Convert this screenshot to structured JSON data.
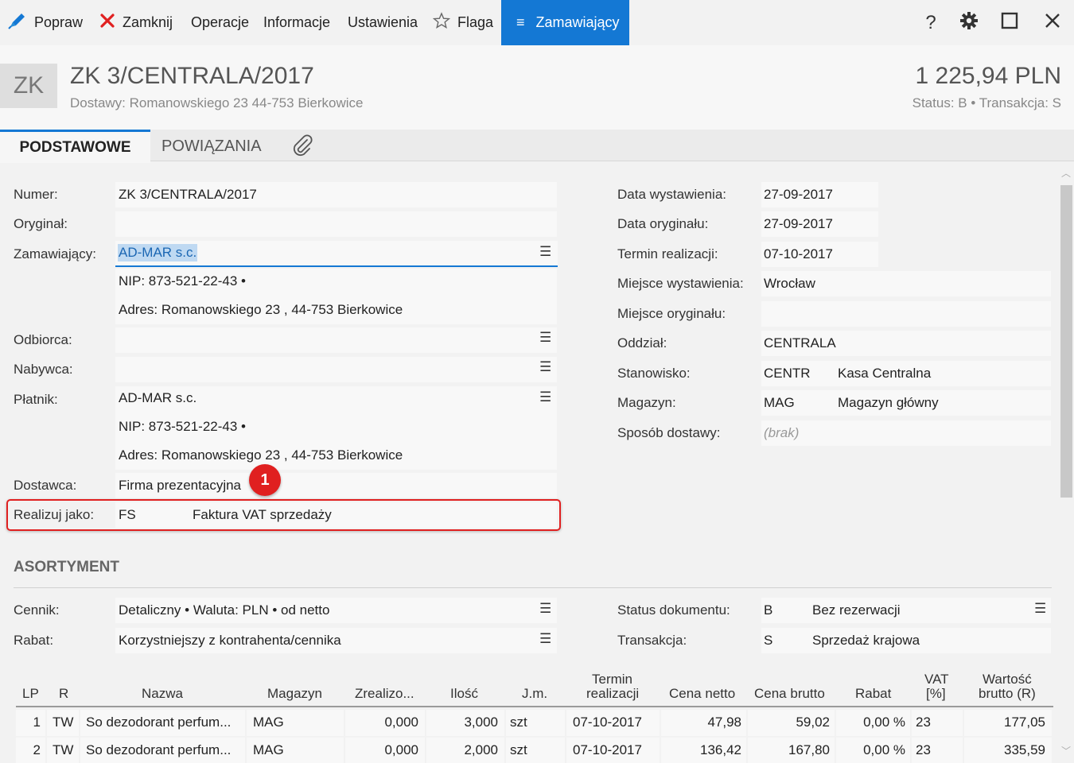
{
  "toolbar": {
    "popraw": "Popraw",
    "zamknij": "Zamknij",
    "operacje": "Operacje",
    "informacje": "Informacje",
    "ustawienia": "Ustawienia",
    "flaga": "Flaga",
    "zamawiajacy": "Zamawiający",
    "help": "?"
  },
  "header": {
    "badge": "ZK",
    "title": "ZK 3/CENTRALA/2017",
    "address": "Dostawy: Romanowskiego 23  44-753 Bierkowice",
    "amount": "1 225,94 PLN",
    "status": "Status:  B  •  Transakcja:  S"
  },
  "tabs": {
    "tab1": "PODSTAWOWE",
    "tab2": "POWIĄZANIA"
  },
  "left": {
    "numer_label": "Numer:",
    "numer_value": "ZK 3/CENTRALA/2017",
    "oryginal_label": "Oryginał:",
    "zamawiajacy_label": "Zamawiający:",
    "zamawiajacy_value": "AD-MAR s.c.",
    "zam_nip": "NIP:  873-521-22-43  •",
    "zam_adres": "Adres:  Romanowskiego 23 , 44-753 Bierkowice",
    "odbiorca_label": "Odbiorca:",
    "nabywca_label": "Nabywca:",
    "platnik_label": "Płatnik:",
    "platnik_value": "AD-MAR s.c.",
    "plat_nip": "NIP:  873-521-22-43  •",
    "plat_adres": "Adres:  Romanowskiego 23 , 44-753 Bierkowice",
    "dostawca_label": "Dostawca:",
    "dostawca_value": "Firma prezentacyjna",
    "realizuj_label": "Realizuj jako:",
    "realizuj_code": "FS",
    "realizuj_value": "Faktura VAT sprzedaży",
    "marker": "1"
  },
  "right": {
    "data_wyst_label": "Data wystawienia:",
    "data_wyst_value": "27-09-2017",
    "data_oryg_label": "Data oryginału:",
    "data_oryg_value": "27-09-2017",
    "termin_label": "Termin realizacji:",
    "termin_value": "07-10-2017",
    "miejsce_wyst_label": "Miejsce wystawienia:",
    "miejsce_wyst_value": "Wrocław",
    "miejsce_oryg_label": "Miejsce oryginału:",
    "oddzial_label": "Oddział:",
    "oddzial_value": "CENTRALA",
    "stanowisko_label": "Stanowisko:",
    "stanowisko_code": "CENTR",
    "stanowisko_value": "Kasa Centralna",
    "magazyn_label": "Magazyn:",
    "magazyn_code": "MAG",
    "magazyn_value": "Magazyn główny",
    "sposob_label": "Sposób dostawy:",
    "sposob_value": "(brak)"
  },
  "asortyment": {
    "title": "ASORTYMENT",
    "cennik_label": "Cennik:",
    "cennik_value": "Detaliczny • Waluta: PLN • od netto",
    "rabat_label": "Rabat:",
    "rabat_value": "Korzystniejszy z kontrahenta/cennika",
    "status_label": "Status dokumentu:",
    "status_code": "B",
    "status_value": "Bez rezerwacji",
    "transakcja_label": "Transakcja:",
    "transakcja_code": "S",
    "transakcja_value": "Sprzedaż krajowa"
  },
  "table": {
    "headers": {
      "lp": "LP",
      "r": "R",
      "nazwa": "Nazwa",
      "magazyn": "Magazyn",
      "zrealizo": "Zrealizo...",
      "ilosc": "Ilość",
      "jm": "J.m.",
      "termin1": "Termin",
      "termin2": "realizacji",
      "cena_netto": "Cena netto",
      "cena_brutto": "Cena brutto",
      "rabat": "Rabat",
      "vat1": "VAT",
      "vat2": "[%]",
      "wartosc1": "Wartość",
      "wartosc2": "brutto (R)"
    },
    "rows": [
      {
        "lp": "1",
        "r": "TW",
        "nazwa": "So dezodorant perfum...",
        "magazyn": "MAG",
        "zrealizo": "0,000",
        "ilosc": "3,000",
        "jm": "szt",
        "termin": "07-10-2017",
        "cena_netto": "47,98",
        "cena_brutto": "59,02",
        "rabat": "0,00 %",
        "vat": "23",
        "wartosc": "177,05"
      },
      {
        "lp": "2",
        "r": "TW",
        "nazwa": "So dezodorant perfum...",
        "magazyn": "MAG",
        "zrealizo": "0,000",
        "ilosc": "2,000",
        "jm": "szt",
        "termin": "07-10-2017",
        "cena_netto": "136,42",
        "cena_brutto": "167,80",
        "rabat": "0,00 %",
        "vat": "23",
        "wartosc": "335,59"
      }
    ]
  },
  "colors": {
    "accent": "#1478d4",
    "highlight": "#e02020",
    "selection": "#bfd9f2"
  }
}
